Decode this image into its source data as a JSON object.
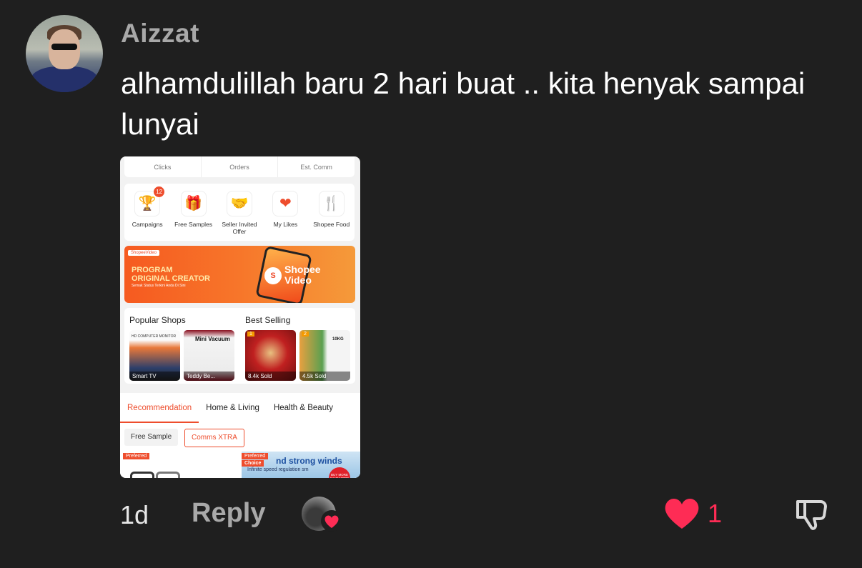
{
  "comment": {
    "username": "Aizzat",
    "text": "alhamdulillah baru 2 hari buat .. kita henyak sampai lunyai",
    "time": "1d",
    "reply_label": "Reply",
    "like_count": "1",
    "colors": {
      "background": "#1f1f1f",
      "like": "#fe2c55",
      "muted": "#a8a8a8"
    }
  },
  "screenshot": {
    "stats": [
      "Clicks",
      "Orders",
      "Est. Comm"
    ],
    "shortcuts": [
      {
        "label": "Campaigns",
        "badge": "12",
        "icon": "trophy-icon"
      },
      {
        "label": "Free Samples",
        "icon": "gift-icon"
      },
      {
        "label": "Seller Invited Offer",
        "icon": "handshake-icon"
      },
      {
        "label": "My Likes",
        "icon": "heart-icon"
      },
      {
        "label": "Shopee Food",
        "icon": "food-icon"
      }
    ],
    "banner": {
      "tag": "ShopeeVideo",
      "title_line1": "PROGRAM",
      "title_line2": "ORIGINAL CREATOR",
      "subtitle": "Semak Status Terkini Anda Di Sini",
      "brand_line1": "Shopee",
      "brand_line2": "Video"
    },
    "popular_shops": {
      "title": "Popular Shops",
      "items": [
        {
          "caption": "Smart TV",
          "label": "HD COMPUTER MONITOR"
        },
        {
          "caption": "Teddy Be...",
          "label": "Mini Vacuum"
        }
      ]
    },
    "best_selling": {
      "title": "Best Selling",
      "items": [
        {
          "caption": "8.4k Sold",
          "rank": "1"
        },
        {
          "caption": "4.5k Sold",
          "rank": "2",
          "label": "10KG"
        }
      ]
    },
    "tabs": [
      "Recommendation",
      "Home & Living",
      "Health & Beauty"
    ],
    "filters": [
      "Free Sample",
      "Comms XTRA"
    ],
    "bottom": {
      "pref1": "Preferred",
      "pref2": "Preferred",
      "choice": "Choice",
      "ad_text": "nd strong winds",
      "ad_sub": "Infinite speed regulation sm",
      "promo": "BUY MORE SAVE MORE"
    }
  }
}
